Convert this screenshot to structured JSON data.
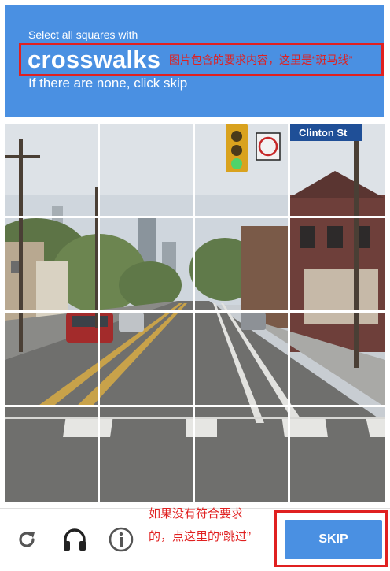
{
  "prompt": {
    "line1": "Select all squares with",
    "target_word": "crosswalks",
    "line3": "If there are none, click skip"
  },
  "annotations": {
    "top_note": "图片包含的要求内容，这里是“斑马线”",
    "bottom_note": "如果没有符合要求的，点这里的“跳过”"
  },
  "image": {
    "street_sign": "Clinton St"
  },
  "footer": {
    "reload_icon": "reload-icon",
    "audio_icon": "headphones-icon",
    "info_icon": "info-icon",
    "skip_label": "SKIP"
  },
  "colors": {
    "brand_blue": "#4a90e2",
    "annotation_red": "#e02020"
  }
}
